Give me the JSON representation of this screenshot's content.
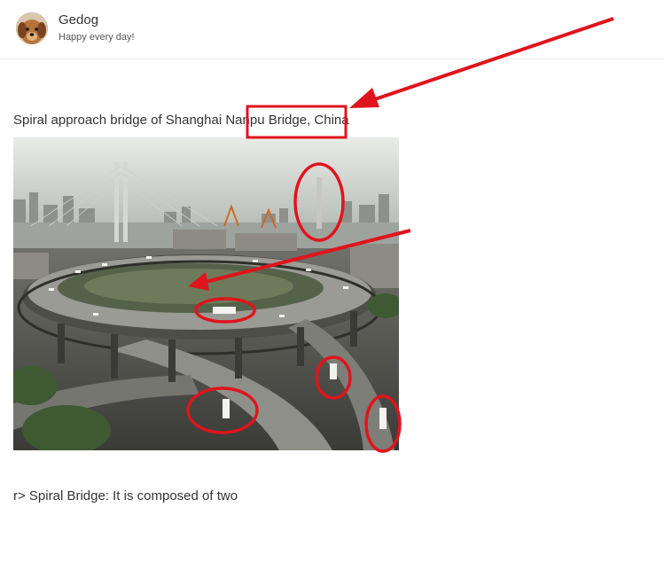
{
  "user": {
    "name": "Gedog",
    "tagline": "Happy every day!"
  },
  "article": {
    "caption": "Spiral approach bridge of Shanghai Nanpu Bridge, China",
    "paragraph": "r> Spiral Bridge: It is composed of two"
  },
  "colors": {
    "annotation": "#e0141c",
    "text": "#333333"
  }
}
